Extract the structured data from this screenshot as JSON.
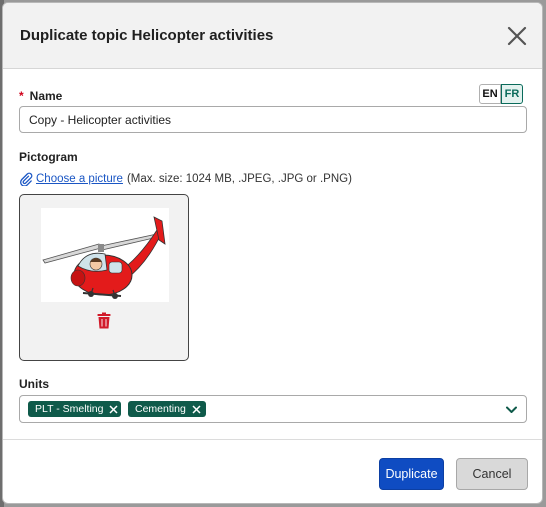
{
  "dialog": {
    "title": "Duplicate topic Helicopter activities",
    "close_icon": "close-icon"
  },
  "name_field": {
    "label": "Name",
    "required_marker": "*",
    "value": "Copy - Helicopter activities",
    "languages": [
      {
        "code": "EN",
        "selected": false
      },
      {
        "code": "FR",
        "selected": true
      }
    ]
  },
  "pictogram": {
    "label": "Pictogram",
    "attach_icon": "paperclip-icon",
    "choose_link": "Choose a picture",
    "hint": "(Max. size: 1024 MB, .JPEG, .JPG or .PNG)",
    "image_description_icon": "helicopter-cartoon",
    "delete_icon": "trash-icon"
  },
  "units": {
    "label": "Units",
    "chips": [
      {
        "label": "PLT - Smelting"
      },
      {
        "label": "Cementing"
      }
    ],
    "dropdown_icon": "chevron-down-icon"
  },
  "footer": {
    "primary_label": "Duplicate",
    "secondary_label": "Cancel"
  },
  "colors": {
    "accent_teal": "#0f5a4a",
    "primary_blue": "#0f4cc2",
    "required_red": "#d0021b",
    "link_blue": "#1a56c4",
    "delete_red": "#d11a2a"
  }
}
